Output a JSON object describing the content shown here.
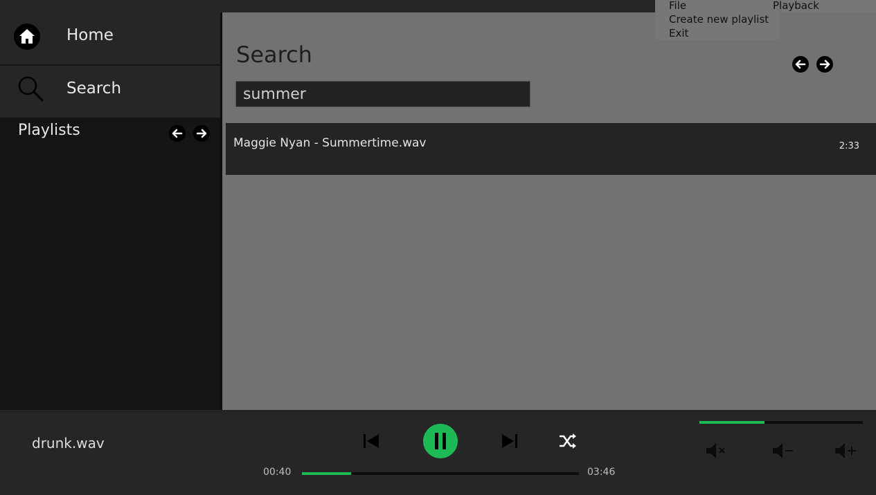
{
  "sidebar": {
    "nav": [
      {
        "label": "Home",
        "icon": "home-icon"
      },
      {
        "label": "Search",
        "icon": "search-icon"
      }
    ],
    "playlists_title": "Playlists"
  },
  "main": {
    "title": "Search",
    "search_value": "summer",
    "results": [
      {
        "title": "Maggie Nyan - Summertime.wav",
        "duration": "2:33"
      }
    ]
  },
  "menu": {
    "file": "File",
    "playback": "Playback",
    "items": [
      "Create new playlist",
      "Exit"
    ]
  },
  "player": {
    "track": "drunk.wav",
    "elapsed": "00:40",
    "total": "03:46",
    "progress": 0.177,
    "volume": 0.4
  },
  "colors": {
    "accent": "#1db954",
    "sidebar_bg": "#141414",
    "main_bg": "#727272",
    "row_bg": "#242424"
  }
}
